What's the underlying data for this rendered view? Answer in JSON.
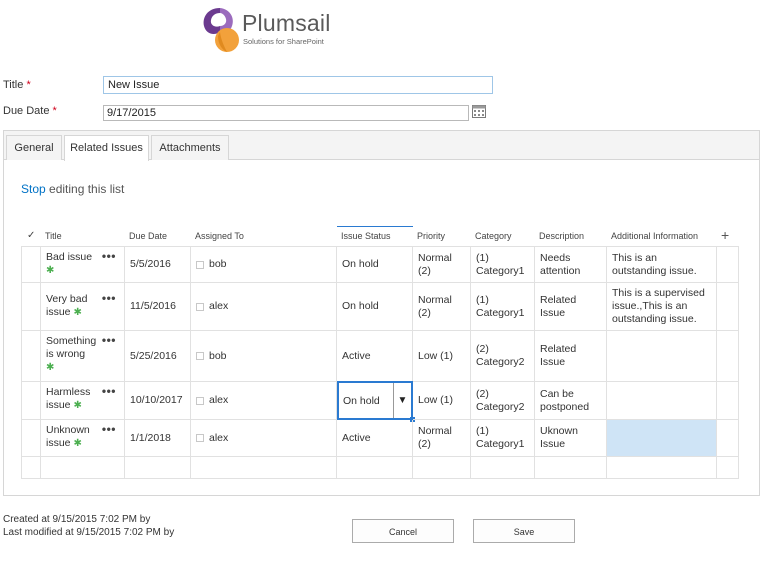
{
  "logo": {
    "name": "Plumsail",
    "tagline": "Solutions for SharePoint"
  },
  "form": {
    "title_label": "Title",
    "title_value": "New Issue",
    "due_label": "Due Date",
    "due_value": "9/17/2015",
    "required_mark": "*"
  },
  "tabs": [
    {
      "label": "General"
    },
    {
      "label": "Related Issues",
      "active": true
    },
    {
      "label": "Attachments"
    }
  ],
  "list": {
    "stop_link": "Stop",
    "stop_rest": " editing this list",
    "columns": [
      "Title",
      "Due Date",
      "Assigned To",
      "Issue Status",
      "Priority",
      "Category",
      "Description",
      "Additional Information"
    ],
    "check_icon": "✓",
    "add_icon": "+",
    "rows": [
      {
        "title": "Bad issue",
        "due": "5/5/2016",
        "assigned": "bob",
        "status": "On hold",
        "priority": "Normal (2)",
        "category": "(1) Category1",
        "description": "Needs attention",
        "info": "This is an outstanding issue."
      },
      {
        "title": "Very bad issue",
        "due": "11/5/2016",
        "assigned": "alex",
        "status": "On hold",
        "priority": "Normal (2)",
        "category": "(1) Category1",
        "description": "Related Issue",
        "info": "This is a supervised issue.,This is an outstanding issue."
      },
      {
        "title": "Something is wrong",
        "due": "5/25/2016",
        "assigned": "bob",
        "status": "Active",
        "priority": "Low (1)",
        "category": "(2) Category2",
        "description": "Related Issue",
        "info": ""
      },
      {
        "title": "Harmless issue",
        "due": "10/10/2017",
        "assigned": "alex",
        "status": "On hold",
        "priority": "Low (1)",
        "category": "(2) Category2",
        "description": "Can be postponed",
        "info": ""
      },
      {
        "title": "Unknown issue",
        "due": "1/1/2018",
        "assigned": "alex",
        "status": "Active",
        "priority": "Normal (2)",
        "category": "(1) Category1",
        "description": "Uknown Issue",
        "info": ""
      }
    ]
  },
  "footer": {
    "created": "Created at 9/15/2015 7:02 PM by",
    "modified": "Last modified at 9/15/2015 7:02 PM by",
    "cancel": "Cancel",
    "save": "Save"
  },
  "colors": {
    "accent": "#0072c6",
    "selection": "#cfe4f6",
    "logo_purple": "#6b3a8f",
    "logo_orange": "#f2a13b"
  }
}
